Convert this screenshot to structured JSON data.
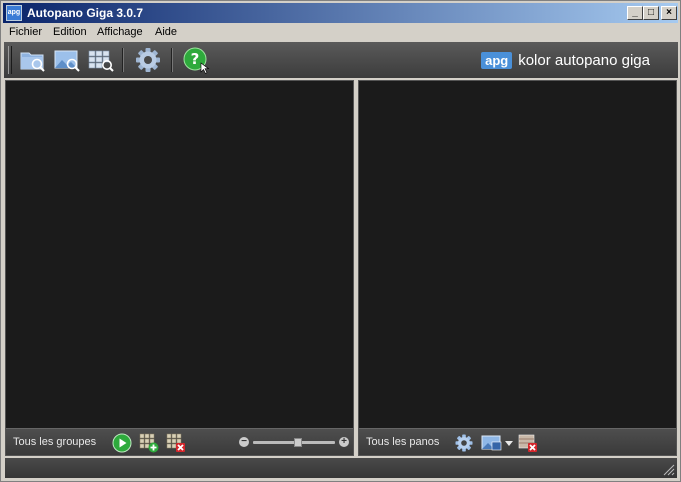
{
  "window": {
    "title": "Autopano Giga 3.0.7",
    "icon_text": "apg",
    "controls": {
      "minimize": "_",
      "maximize": "□",
      "close": "×"
    }
  },
  "menubar": {
    "items": [
      {
        "label": "Fichier"
      },
      {
        "label": "Edition"
      },
      {
        "label": "Affichage"
      },
      {
        "label": "Aide"
      }
    ]
  },
  "toolbar": {
    "tools": [
      "folder-search-icon",
      "image-search-icon",
      "grid-detect-icon",
      "gear-icon",
      "help-icon"
    ],
    "logo": {
      "badge": "apg",
      "brand": "kolor autopano giga"
    }
  },
  "left_panel": {
    "footer_label": "Tous les groupes",
    "icons": [
      "play-icon",
      "add-group-icon",
      "remove-group-icon"
    ],
    "zoom": {
      "minus": "−",
      "plus": "+",
      "level": 0.55
    }
  },
  "right_panel": {
    "footer_label": "Tous les panos",
    "icons": [
      "gear-icon",
      "render-icon",
      "dropdown-arrow-icon",
      "remove-pano-icon"
    ]
  },
  "colors": {
    "title_start": "#0a246a",
    "title_end": "#a6caf0",
    "panel_bg": "#1b1b1b",
    "accent_green": "#2eaa3c",
    "accent_blue": "#4a90d9"
  }
}
